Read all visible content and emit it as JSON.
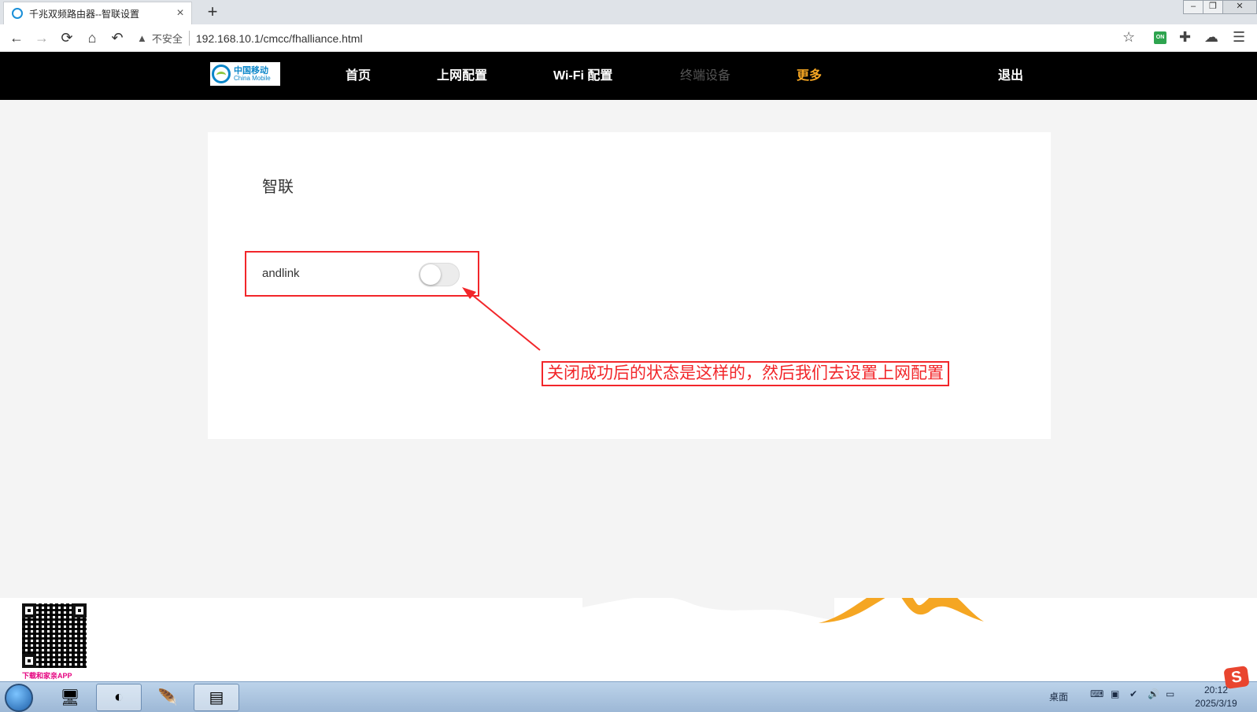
{
  "browser": {
    "tab_title": "千兆双频路由器--智联设置",
    "tab_close": "×",
    "new_tab": "+",
    "security_label": "不安全",
    "url": "192.168.10.1/cmcc/fhalliance.html",
    "extension_badge": "ON",
    "icons": [
      "back-icon",
      "forward-icon",
      "reload-icon",
      "home-icon",
      "undo-icon",
      "star-icon",
      "puzzle-icon",
      "cloud-download-icon",
      "menu-icon"
    ]
  },
  "router": {
    "logo_cn": "中国移动",
    "logo_en": "China Mobile",
    "nav": {
      "home": "首页",
      "internet": "上网配置",
      "wifi": "Wi-Fi 配置",
      "devices": "终端设备",
      "more": "更多",
      "logout": "退出"
    },
    "nav_state": {
      "devices": "disabled",
      "more": "active"
    },
    "page": {
      "section_title": "智联",
      "andlink_label": "andlink",
      "andlink_enabled": false
    },
    "annotation": "关闭成功后的状态是这样的，然后我们去设置上网配置",
    "qr_caption": "下载和家亲APP"
  },
  "taskbar": {
    "desktop_label": "桌面",
    "time": "20:12",
    "date": "2025/3/19"
  },
  "colors": {
    "accent": "#f5a623",
    "annotation_red": "#f2262a",
    "header_bg": "#000000"
  }
}
